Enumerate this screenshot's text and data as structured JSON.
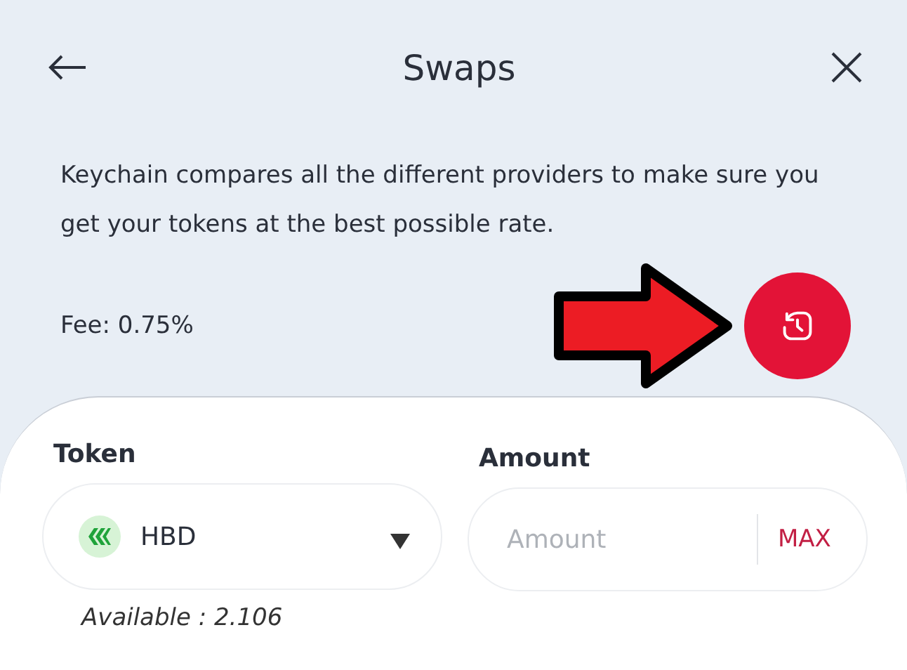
{
  "header": {
    "title": "Swaps"
  },
  "intro": "Keychain compares all the different providers to make sure you get your tokens at the best possible rate.",
  "fee": "Fee: 0.75%",
  "form": {
    "token_label": "Token",
    "token": "HBD",
    "amount_label": "Amount",
    "amount_placeholder": "Amount",
    "max_button": "MAX",
    "available": "Available : 2.106"
  }
}
